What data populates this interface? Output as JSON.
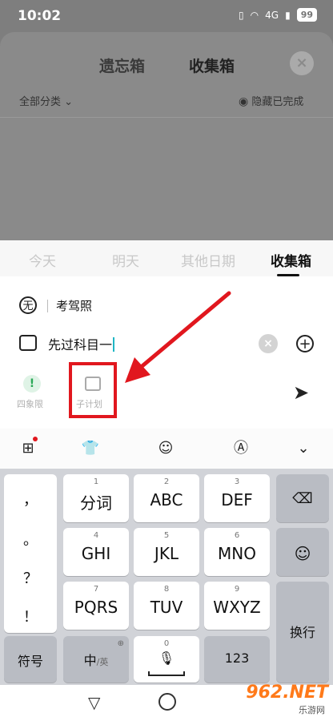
{
  "status": {
    "time": "10:02",
    "battery": "99",
    "net": "4G"
  },
  "background": {
    "tabs": [
      "遗忘箱",
      "收集箱"
    ],
    "filter": "全部分类",
    "hide_done": "隐藏已完成"
  },
  "date_tabs": [
    "今天",
    "明天",
    "其他日期",
    "收集箱"
  ],
  "category": {
    "icon_char": "无",
    "text": "考驾照"
  },
  "task_input": {
    "value": "先过科目一"
  },
  "actions": {
    "quadrant_label": "四象限",
    "subplan_label": "子计划"
  },
  "keyboard": {
    "left_punct": [
      "，",
      "。",
      "？",
      "！"
    ],
    "rows": [
      [
        {
          "num": "1",
          "label": "分词"
        },
        {
          "num": "2",
          "label": "ABC"
        },
        {
          "num": "3",
          "label": "DEF"
        }
      ],
      [
        {
          "num": "4",
          "label": "GHI"
        },
        {
          "num": "5",
          "label": "JKL"
        },
        {
          "num": "6",
          "label": "MNO"
        }
      ],
      [
        {
          "num": "7",
          "label": "PQRS"
        },
        {
          "num": "8",
          "label": "TUV"
        },
        {
          "num": "9",
          "label": "WXYZ"
        }
      ]
    ],
    "symbol_key": "符号",
    "lang_key_main": "中",
    "lang_key_sub": "/英",
    "zero_num": "0",
    "num_key": "123",
    "enter_key": "换行"
  },
  "watermark": {
    "brand": "962.NET",
    "sub": "乐游网"
  },
  "colors": {
    "accent_red": "#e1171e",
    "cursor": "#1fb6c4",
    "green": "#2aa856"
  }
}
